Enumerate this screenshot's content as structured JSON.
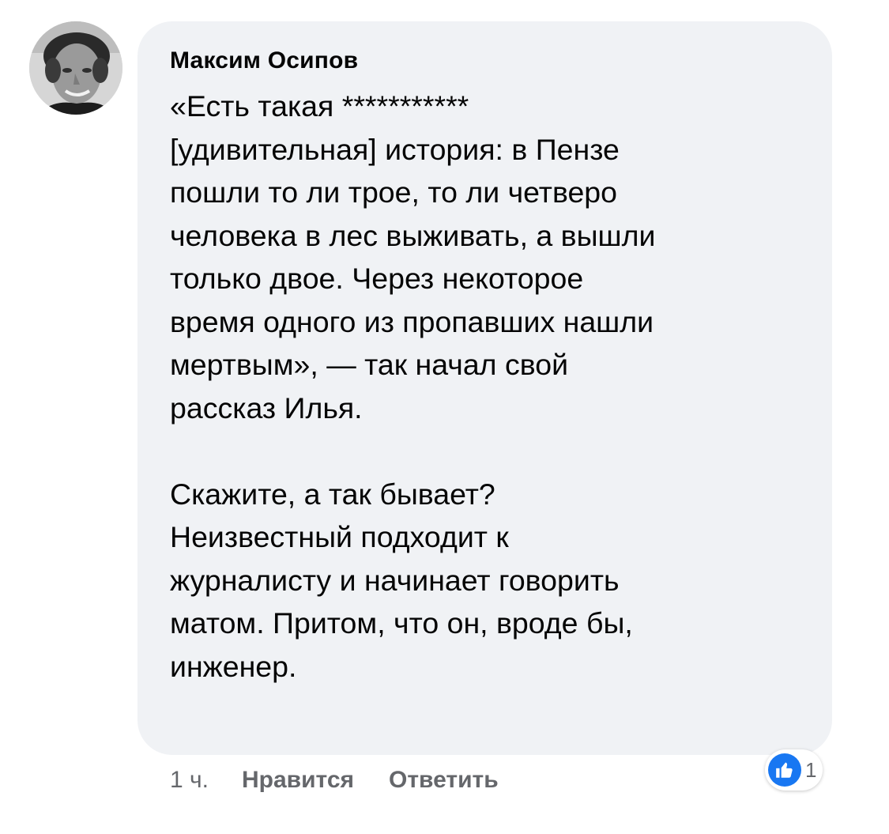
{
  "comment": {
    "author": "Максим Осипов",
    "paragraphs": [
      [
        "«Есть такая ***********",
        "[удивительная] история: в Пензе",
        "пошли то ли трое, то ли четверо",
        "человека в лес выживать, а вышли",
        "только двое. Через некоторое",
        "время одного из пропавших нашли",
        "мертвым», — так начал свой",
        "рассказ Илья."
      ],
      [
        "Скажите, а так бывает?",
        "Неизвестный подходит к",
        "журналисту и начинает говорить",
        "матом. Притом, что он, вроде бы,",
        "инженер."
      ]
    ]
  },
  "actions": {
    "time": "1 ч.",
    "like_label": "Нравится",
    "reply_label": "Ответить"
  },
  "reactions": {
    "icon": "thumbs-up-icon",
    "count": "1",
    "color": "#1877f2"
  },
  "colors": {
    "bubble_background": "#f0f2f5",
    "secondary_text": "#65676b",
    "primary_text": "#050505"
  }
}
